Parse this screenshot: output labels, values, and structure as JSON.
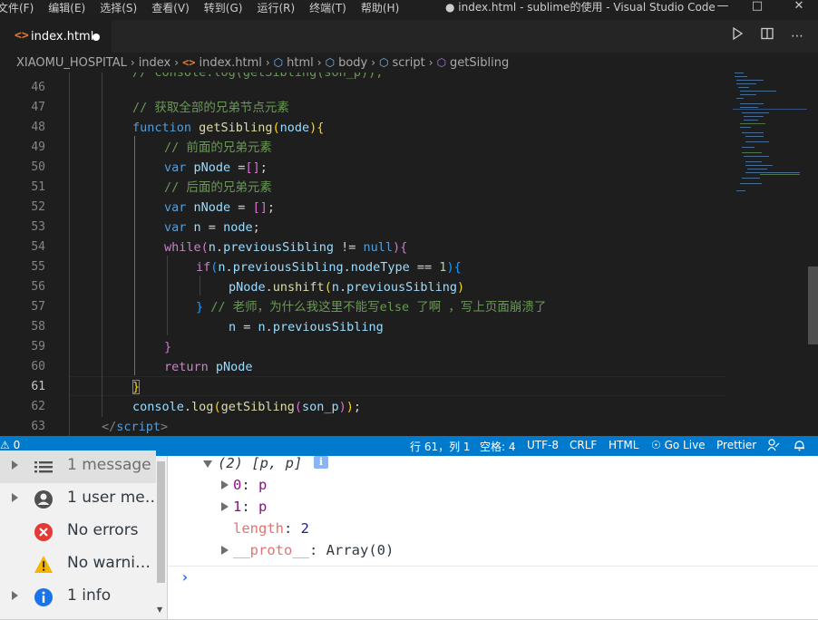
{
  "menubar": {
    "items": [
      "文件(F)",
      "编辑(E)",
      "选择(S)",
      "查看(V)",
      "转到(G)",
      "运行(R)",
      "终端(T)",
      "帮助(H)"
    ],
    "window_title": "● index.html - sublime的使用 - Visual Studio Code"
  },
  "tab": {
    "label": "index.html"
  },
  "breadcrumb": [
    "XIAOMU_HOSPITAL",
    "index",
    "index.html",
    "html",
    "body",
    "script",
    "getSibling"
  ],
  "editor": {
    "line_numbers": [
      "46",
      "47",
      "48",
      "49",
      "50",
      "51",
      "52",
      "53",
      "54",
      "55",
      "56",
      "57",
      "58",
      "59",
      "60",
      "61",
      "62",
      "63"
    ],
    "active_line": "61",
    "top_partial": "// console.log(getSibling(son_p));",
    "comment_get_all": "// 获取全部的兄弟节点元素",
    "comment_prev": "// 前面的兄弟元素",
    "comment_next": "// 后面的兄弟元素",
    "comment_question": "// 老师，为什么我这里不能写else 了啊 ，写上页面崩溃了"
  },
  "statusbar": {
    "problems": "0",
    "position": "行 61，列 1",
    "spaces": "空格: 4",
    "encoding": "UTF-8",
    "eol": "CRLF",
    "language": "HTML",
    "golive": "Go Live",
    "prettier": "Prettier"
  },
  "console_sidebar": {
    "items": [
      {
        "label": "1 message",
        "icon": "list-icon"
      },
      {
        "label": "1 user me…",
        "icon": "user-icon"
      },
      {
        "label": "No errors",
        "icon": "error-icon"
      },
      {
        "label": "No warni…",
        "icon": "warning-icon"
      },
      {
        "label": "1 info",
        "icon": "info-icon"
      }
    ]
  },
  "console_output": {
    "array_summary": "(2) [p, p]",
    "item0_key": "0",
    "item0_value": "p",
    "item1_key": "1",
    "item1_value": "p",
    "length_key": "length",
    "length_value": "2",
    "proto_key": "__proto__",
    "proto_value": "Array(0)"
  },
  "colors": {
    "statusbar": "#007acc",
    "editor_bg": "#1e1e1e",
    "keyword": "#569cd6",
    "function": "#dcdcaa",
    "variable": "#9cdcfe",
    "comment": "#6a9955"
  }
}
